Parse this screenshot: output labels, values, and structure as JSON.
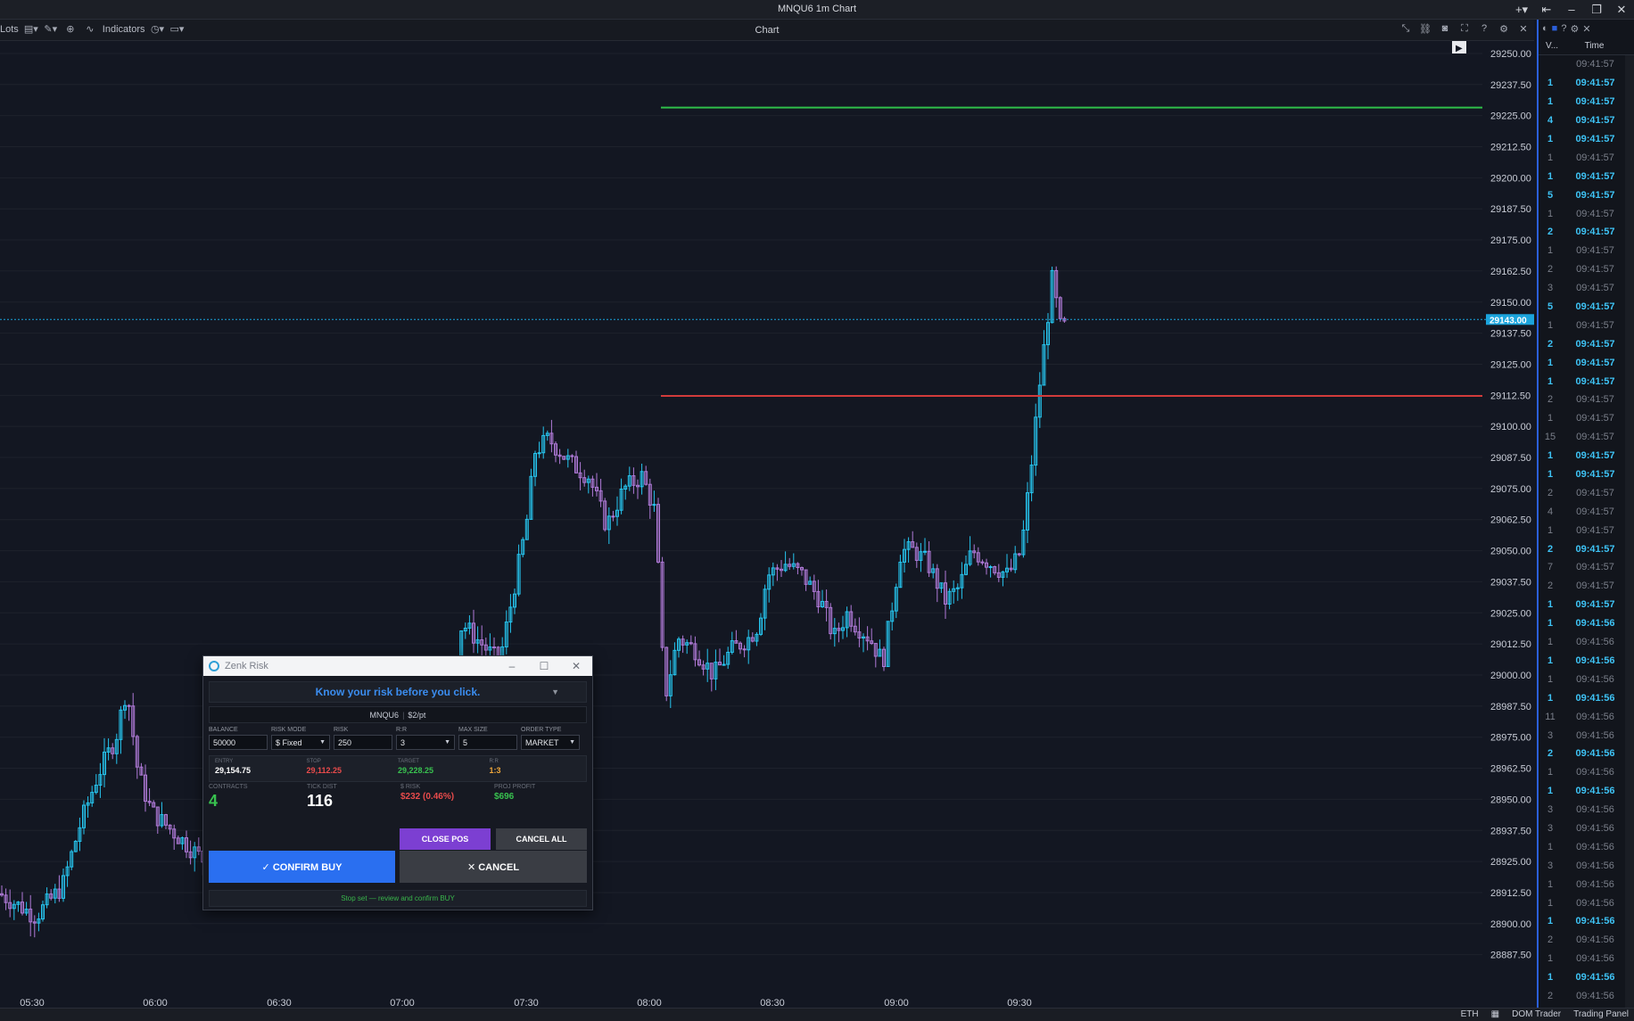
{
  "window": {
    "title": "MNQU6 1m Chart",
    "controls": [
      "+▾",
      "⇤",
      "–",
      "❐",
      "✕"
    ]
  },
  "toolbar": {
    "lots_label": "Lots",
    "indicators_label": "Indicators",
    "center_title": "Chart"
  },
  "dom_panel": {
    "col_volume": "V...",
    "col_time": "Time",
    "rows": [
      {
        "v": "",
        "t": "09:41:57",
        "hi": false
      },
      {
        "v": "1",
        "t": "09:41:57",
        "hi": true
      },
      {
        "v": "1",
        "t": "09:41:57",
        "hi": true
      },
      {
        "v": "4",
        "t": "09:41:57",
        "hi": true
      },
      {
        "v": "1",
        "t": "09:41:57",
        "hi": true
      },
      {
        "v": "1",
        "t": "09:41:57",
        "hi": false
      },
      {
        "v": "1",
        "t": "09:41:57",
        "hi": true
      },
      {
        "v": "5",
        "t": "09:41:57",
        "hi": true
      },
      {
        "v": "1",
        "t": "09:41:57",
        "hi": false
      },
      {
        "v": "2",
        "t": "09:41:57",
        "hi": true
      },
      {
        "v": "1",
        "t": "09:41:57",
        "hi": false
      },
      {
        "v": "2",
        "t": "09:41:57",
        "hi": false
      },
      {
        "v": "3",
        "t": "09:41:57",
        "hi": false
      },
      {
        "v": "5",
        "t": "09:41:57",
        "hi": true
      },
      {
        "v": "1",
        "t": "09:41:57",
        "hi": false
      },
      {
        "v": "2",
        "t": "09:41:57",
        "hi": true
      },
      {
        "v": "1",
        "t": "09:41:57",
        "hi": true
      },
      {
        "v": "1",
        "t": "09:41:57",
        "hi": true
      },
      {
        "v": "2",
        "t": "09:41:57",
        "hi": false
      },
      {
        "v": "1",
        "t": "09:41:57",
        "hi": false
      },
      {
        "v": "15",
        "t": "09:41:57",
        "hi": false
      },
      {
        "v": "1",
        "t": "09:41:57",
        "hi": true
      },
      {
        "v": "1",
        "t": "09:41:57",
        "hi": true
      },
      {
        "v": "2",
        "t": "09:41:57",
        "hi": false
      },
      {
        "v": "4",
        "t": "09:41:57",
        "hi": false
      },
      {
        "v": "1",
        "t": "09:41:57",
        "hi": false
      },
      {
        "v": "2",
        "t": "09:41:57",
        "hi": true
      },
      {
        "v": "7",
        "t": "09:41:57",
        "hi": false
      },
      {
        "v": "2",
        "t": "09:41:57",
        "hi": false
      },
      {
        "v": "1",
        "t": "09:41:57",
        "hi": true
      },
      {
        "v": "1",
        "t": "09:41:56",
        "hi": true
      },
      {
        "v": "1",
        "t": "09:41:56",
        "hi": false
      },
      {
        "v": "1",
        "t": "09:41:56",
        "hi": true
      },
      {
        "v": "1",
        "t": "09:41:56",
        "hi": false
      },
      {
        "v": "1",
        "t": "09:41:56",
        "hi": true
      },
      {
        "v": "11",
        "t": "09:41:56",
        "hi": false
      },
      {
        "v": "3",
        "t": "09:41:56",
        "hi": false
      },
      {
        "v": "2",
        "t": "09:41:56",
        "hi": true
      },
      {
        "v": "1",
        "t": "09:41:56",
        "hi": false
      },
      {
        "v": "1",
        "t": "09:41:56",
        "hi": true
      },
      {
        "v": "3",
        "t": "09:41:56",
        "hi": false
      },
      {
        "v": "3",
        "t": "09:41:56",
        "hi": false
      },
      {
        "v": "1",
        "t": "09:41:56",
        "hi": false
      },
      {
        "v": "3",
        "t": "09:41:56",
        "hi": false
      },
      {
        "v": "1",
        "t": "09:41:56",
        "hi": false
      },
      {
        "v": "1",
        "t": "09:41:56",
        "hi": false
      },
      {
        "v": "1",
        "t": "09:41:56",
        "hi": true
      },
      {
        "v": "2",
        "t": "09:41:56",
        "hi": false
      },
      {
        "v": "1",
        "t": "09:41:56",
        "hi": false
      },
      {
        "v": "1",
        "t": "09:41:56",
        "hi": true
      },
      {
        "v": "2",
        "t": "09:41:56",
        "hi": false
      }
    ]
  },
  "statusbar": {
    "session": "ETH",
    "dom_trader": "DOM Trader",
    "trading_panel": "Trading Panel"
  },
  "chart_data": {
    "type": "candlestick",
    "price_ticks": [
      "29250.00",
      "29237.50",
      "29225.00",
      "29212.50",
      "29200.00",
      "29187.50",
      "29175.00",
      "29162.50",
      "29150.00",
      "29137.50",
      "29125.00",
      "29112.50",
      "29100.00",
      "29087.50",
      "29075.00",
      "29062.50",
      "29050.00",
      "29037.50",
      "29025.00",
      "29012.50",
      "29000.00",
      "28987.50",
      "28975.00",
      "28962.50",
      "28950.00",
      "28937.50",
      "28925.00",
      "28912.50",
      "28900.00",
      "28887.50"
    ],
    "time_ticks": [
      "05:30",
      "06:00",
      "06:30",
      "07:00",
      "07:30",
      "08:00",
      "08:30",
      "09:00",
      "09:30"
    ],
    "ylim": [
      28882,
      29255
    ],
    "last_price": "29143.00",
    "last_price_value": 29143,
    "target_line": 29228.25,
    "stop_line": 29112.25,
    "colors": {
      "up": "#26c6f0",
      "down": "#b07ad8",
      "target": "#2fbf4a",
      "stop": "#d23b3b",
      "price_tag": "#1ba4dc",
      "grid": "#1e222c"
    }
  },
  "risk_dialog": {
    "title": "Zenk Risk",
    "banner": "Know your risk before you click.",
    "symbol": "MNQU6",
    "point_value": "$2/pt",
    "fields": [
      {
        "label": "BALANCE",
        "value": "50000",
        "dropdown": false
      },
      {
        "label": "RISK MODE",
        "value": "$ Fixed",
        "dropdown": true
      },
      {
        "label": "RISK",
        "value": "250",
        "dropdown": false
      },
      {
        "label": "R:R",
        "value": "3",
        "dropdown": true
      },
      {
        "label": "MAX SIZE",
        "value": "5",
        "dropdown": false
      },
      {
        "label": "ORDER TYPE",
        "value": "MARKET",
        "dropdown": true
      }
    ],
    "calc": [
      {
        "label": "ENTRY",
        "value": "29,154.75",
        "color": "#ffffff"
      },
      {
        "label": "STOP",
        "value": "29,112.25",
        "color": "#e84b4b"
      },
      {
        "label": "TARGET",
        "value": "29,228.25",
        "color": "#38c24f"
      },
      {
        "label": "R:R",
        "value": "1:3",
        "color": "#f0a73a"
      }
    ],
    "contracts_label": "CONTRACTS",
    "contracts_value": "4",
    "tick_dist_label": "TICK DIST",
    "tick_dist_value": "116",
    "risk_label": "$ RISK",
    "risk_value": "$232 (0.46%)",
    "profit_label": "PROJ PROFIT",
    "profit_value": "$696",
    "close_pos": "CLOSE POS",
    "cancel_all": "CANCEL ALL",
    "confirm_buy": "✓ CONFIRM BUY",
    "cancel": "✕ CANCEL",
    "note": "Stop set — review and confirm BUY"
  }
}
